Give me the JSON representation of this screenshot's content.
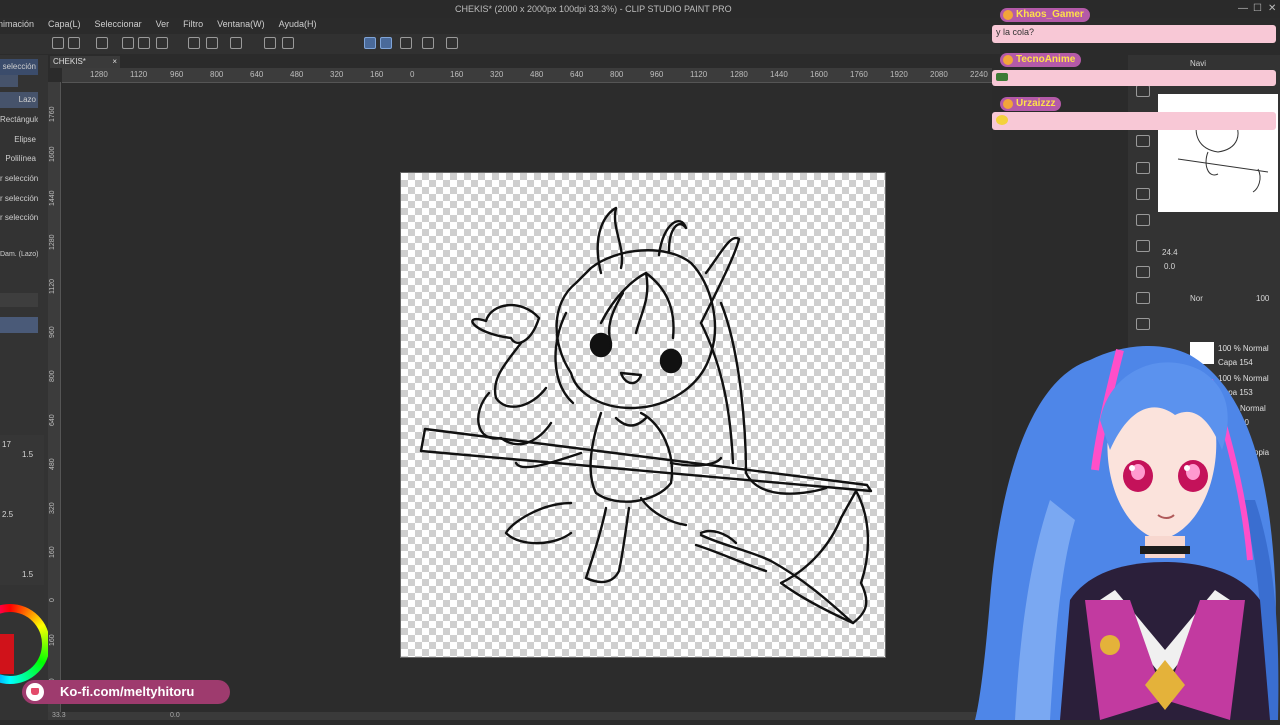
{
  "window": {
    "title": "CHEKIS* (2000 x 2000px 100dpi 33.3%) - CLIP STUDIO PAINT PRO",
    "minimize": "—",
    "maximize": "☐",
    "close": "✕"
  },
  "menu": {
    "items": [
      {
        "label": "Animación"
      },
      {
        "label": "Capa(L)"
      },
      {
        "label": "Seleccionar"
      },
      {
        "label": "Ver"
      },
      {
        "label": "Filtro"
      },
      {
        "label": "Ventana(W)"
      },
      {
        "label": "Ayuda(H)"
      }
    ]
  },
  "document_tab": {
    "label": "CHEKIS*",
    "close": "×"
  },
  "ruler_h": [
    "1280",
    "1120",
    "960",
    "800",
    "640",
    "480",
    "320",
    "160",
    "0",
    "160",
    "320",
    "480",
    "640",
    "800",
    "960",
    "1120",
    "1280",
    "1440",
    "1600",
    "1760",
    "1920",
    "2080",
    "2240"
  ],
  "ruler_v": [
    "1760",
    "1600",
    "1440",
    "1280",
    "1120",
    "960",
    "800",
    "640",
    "480",
    "320",
    "160",
    "0",
    "160",
    "320"
  ],
  "subtools": {
    "header": "selección",
    "items": [
      {
        "label": "Lazo",
        "selected": true
      },
      {
        "label": "Rectángulo",
        "selected": false
      },
      {
        "label": "Elipse",
        "selected": false
      },
      {
        "label": "Polilínea",
        "selected": false
      },
      {
        "label": "r selección",
        "selected": false
      },
      {
        "label": "r selección",
        "selected": false
      },
      {
        "label": "r selección",
        "selected": false
      }
    ],
    "property_label": "Dam. (Lazo)"
  },
  "tool_property_values": [
    "17",
    "1.5",
    "2.5",
    "1.5"
  ],
  "chat": [
    {
      "user": "Khaos_Gamer",
      "message": "y la cola?"
    },
    {
      "user": "TecnoAnime",
      "message": ""
    },
    {
      "user": "Urzaizzz",
      "message": ""
    }
  ],
  "right_panel": {
    "nav_label": "Navi",
    "zoom_value": "24.4",
    "rotate_value": "0.0",
    "layer_opacity": "100",
    "layers": [
      {
        "label": "100 % Normal"
      },
      {
        "label": "Capa 154"
      },
      {
        "label": "100 % Normal"
      },
      {
        "label": "Capa 153"
      },
      {
        "label": "Normal"
      },
      {
        "label": "00"
      },
      {
        "label": "opia"
      }
    ],
    "blend_mode": "Nor"
  },
  "kofi": {
    "url": "Ko-fi.com/meltyhitoru"
  },
  "status": {
    "zoom": "33.3",
    "angle": "0.0"
  },
  "colors": {
    "accent": "#46536b",
    "chat_name_bg": "#b45aa8",
    "chat_name_fg": "#ffe04a",
    "chat_msg_bg": "#f8c8d6",
    "kofi_bg": "#9e3b6e"
  }
}
